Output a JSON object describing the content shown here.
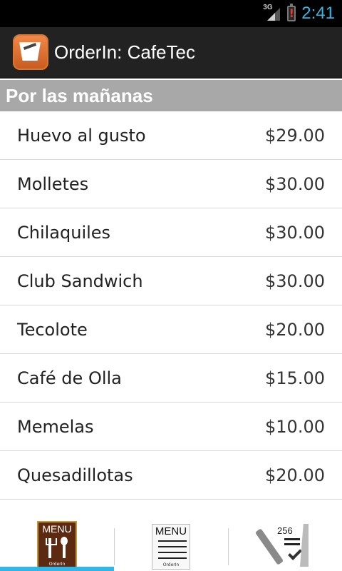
{
  "status_bar": {
    "network": "3G",
    "time": "2:41",
    "battery_icon": "battery-alert-icon"
  },
  "action_bar": {
    "title": "OrderIn: CafeTec",
    "icon": "cafetec-app-icon"
  },
  "section": {
    "title": "Por las mañanas"
  },
  "menu": {
    "items": [
      {
        "name": "Huevo al gusto",
        "price": "$29.00"
      },
      {
        "name": "Molletes",
        "price": "$30.00"
      },
      {
        "name": "Chilaquiles",
        "price": "$30.00"
      },
      {
        "name": "Club Sandwich",
        "price": "$30.00"
      },
      {
        "name": "Tecolote",
        "price": "$20.00"
      },
      {
        "name": "Café de Olla",
        "price": "$15.00"
      },
      {
        "name": "Memelas",
        "price": "$10.00"
      },
      {
        "name": "Quesadillotas",
        "price": "$20.00"
      }
    ]
  },
  "tabs": {
    "menu_book_label": "MENU",
    "menu_book_caption": "OrderIn",
    "menu_sheet_label": "MENU",
    "menu_sheet_caption": "OrderIn",
    "order_count": "256",
    "selected_index": 0
  },
  "colors": {
    "accent": "#33b5e5",
    "action_bar": "#222222",
    "section_header": "#a8a8a8"
  }
}
